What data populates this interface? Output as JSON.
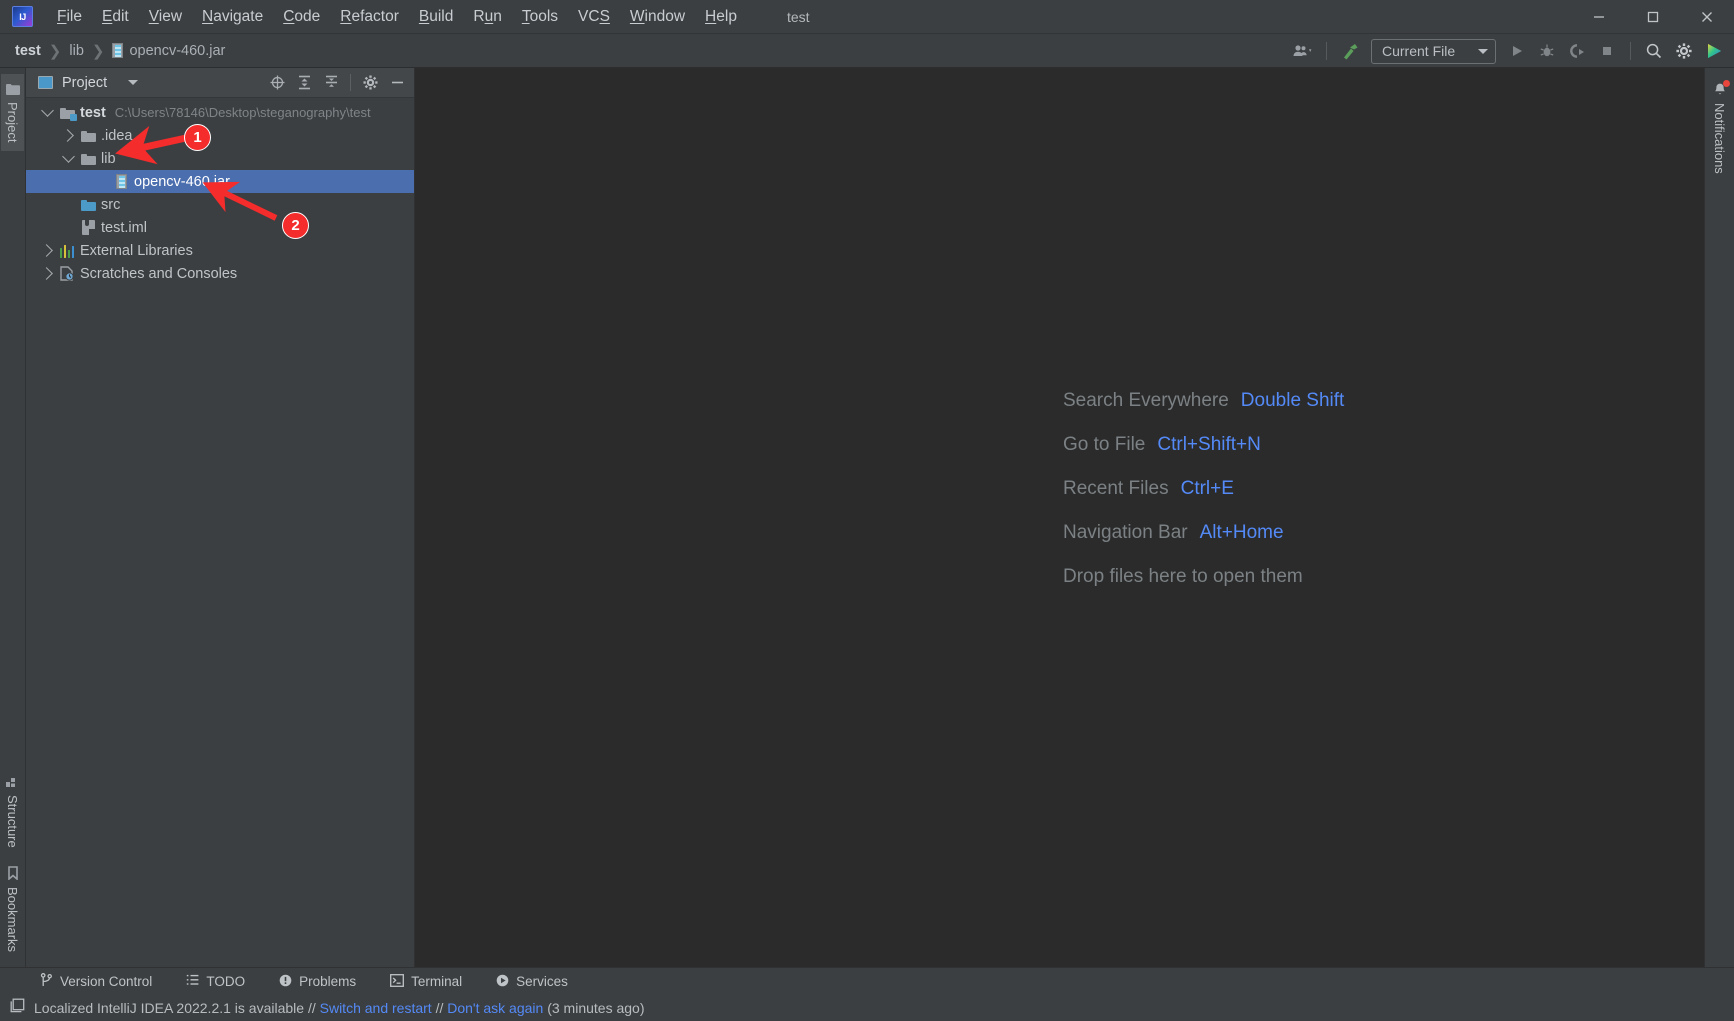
{
  "titlebar": {
    "logo_icon": "intellij-logo",
    "project_name": "test",
    "menus": [
      {
        "label": "File",
        "mnemonic": "F"
      },
      {
        "label": "Edit",
        "mnemonic": "E"
      },
      {
        "label": "View",
        "mnemonic": "V"
      },
      {
        "label": "Navigate",
        "mnemonic": "N"
      },
      {
        "label": "Code",
        "mnemonic": "C"
      },
      {
        "label": "Refactor",
        "mnemonic": "R"
      },
      {
        "label": "Build",
        "mnemonic": "B"
      },
      {
        "label": "Run",
        "mnemonic": "u"
      },
      {
        "label": "Tools",
        "mnemonic": "T"
      },
      {
        "label": "VCS",
        "mnemonic": "S"
      },
      {
        "label": "Window",
        "mnemonic": "W"
      },
      {
        "label": "Help",
        "mnemonic": "H"
      }
    ],
    "minimize": "—",
    "maximize": "□",
    "close": "✕"
  },
  "navbar": {
    "breadcrumbs": [
      {
        "label": "test",
        "icon": ""
      },
      {
        "label": "lib",
        "icon": ""
      },
      {
        "label": "opencv-460.jar",
        "icon": "jar-icon"
      }
    ],
    "separator": "›",
    "run_config": "Current File",
    "icons": [
      "user-dropdown-icon",
      "hammer-build-icon",
      "run-icon",
      "debug-icon",
      "run-with-coverage-icon",
      "stop-icon",
      "search-icon",
      "settings-gear-icon",
      "ide-assistant-icon"
    ]
  },
  "left_stripe": {
    "top_tabs": [
      {
        "label": "Project",
        "icon": "project-folder-icon",
        "active": true
      }
    ],
    "bottom_tabs": [
      {
        "label": "Structure",
        "icon": "structure-icon"
      },
      {
        "label": "Bookmarks",
        "icon": "bookmarks-icon"
      }
    ]
  },
  "right_stripe": {
    "tabs": [
      {
        "label": "Notifications",
        "icon": "bell-icon",
        "badge": true
      }
    ]
  },
  "project_panel": {
    "title": "Project",
    "window_icon": "project-window-icon",
    "dropdown_icon": "chevron-down-icon",
    "actions": [
      "select-opened-file-icon",
      "expand-all-icon",
      "collapse-all-icon",
      "settings-gear-icon",
      "hide-panel-icon"
    ],
    "tree": [
      {
        "name": "test",
        "path": "C:\\Users\\78146\\Desktop\\steganography\\test",
        "indent": 0,
        "arrow": "down",
        "icon": "module-folder-icon",
        "bold": true,
        "selected": false
      },
      {
        "name": ".idea",
        "path": "",
        "indent": 1,
        "arrow": "right",
        "icon": "folder-icon",
        "bold": false,
        "selected": false
      },
      {
        "name": "lib",
        "path": "",
        "indent": 1,
        "arrow": "down",
        "icon": "folder-icon",
        "bold": false,
        "selected": false
      },
      {
        "name": "opencv-460.jar",
        "path": "",
        "indent": 2,
        "arrow": "none",
        "icon": "jar-icon",
        "bold": false,
        "selected": true
      },
      {
        "name": "src",
        "path": "",
        "indent": 1,
        "arrow": "none",
        "icon": "source-folder-icon",
        "bold": false,
        "selected": false
      },
      {
        "name": "test.iml",
        "path": "",
        "indent": 1,
        "arrow": "none",
        "icon": "iml-file-icon",
        "bold": false,
        "selected": false
      },
      {
        "name": "External Libraries",
        "path": "",
        "indent": 0,
        "arrow": "right",
        "icon": "libraries-icon",
        "bold": false,
        "selected": false
      },
      {
        "name": "Scratches and Consoles",
        "path": "",
        "indent": 0,
        "arrow": "right",
        "icon": "scratches-icon",
        "bold": false,
        "selected": false
      }
    ]
  },
  "editor": {
    "tips": [
      {
        "action": "Search Everywhere",
        "key": "Double Shift"
      },
      {
        "action": "Go to File",
        "key": "Ctrl+Shift+N"
      },
      {
        "action": "Recent Files",
        "key": "Ctrl+E"
      },
      {
        "action": "Navigation Bar",
        "key": "Alt+Home"
      },
      {
        "action": "Drop files here to open them",
        "key": ""
      }
    ]
  },
  "tool_windows": [
    {
      "label": "Version Control",
      "icon": "branch-icon"
    },
    {
      "label": "TODO",
      "icon": "list-icon"
    },
    {
      "label": "Problems",
      "icon": "warning-icon"
    },
    {
      "label": "Terminal",
      "icon": "terminal-icon"
    },
    {
      "label": "Services",
      "icon": "services-play-icon"
    }
  ],
  "statusbar": {
    "icon": "notification-window-icon",
    "message_prefix": "Localized IntelliJ IDEA 2022.2.1 is available // ",
    "link1": "Switch and restart",
    "mid": " // ",
    "link2": "Don't ask again",
    "suffix": " (3 minutes ago)"
  },
  "annotations": [
    {
      "label": "1",
      "target": "lib-folder-row"
    },
    {
      "label": "2",
      "target": "opencv-jar-row"
    }
  ],
  "colors": {
    "accent_blue": "#548af7",
    "selection_blue": "#4b6eaf",
    "annotation_red": "#f42c2c",
    "panel_bg": "#3c3f41",
    "editor_bg": "#2b2b2b"
  }
}
